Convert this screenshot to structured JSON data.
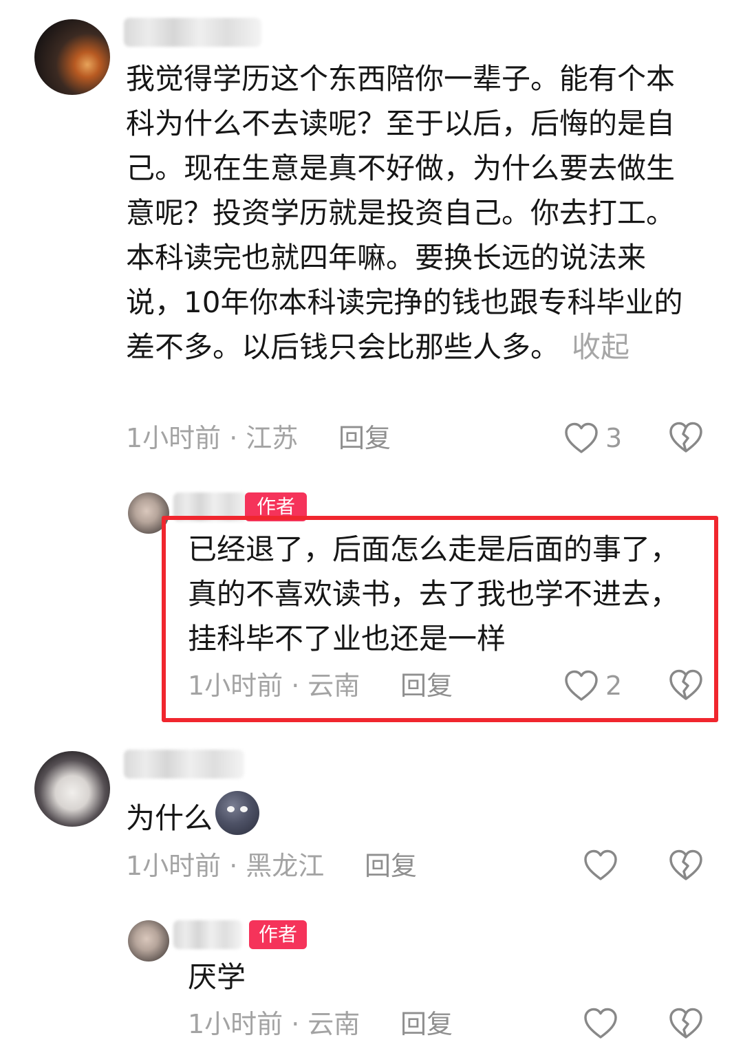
{
  "comments": [
    {
      "text": "我觉得学历这个东西陪你一辈子。能有个本科为什么不去读呢？至于以后，后悔的是自己。现在生意是真不好做，为什么要去做生意呢？投资学历就是投资自己。你去打工。本科读完也就四年嘛。要换长远的说法来说，10年你本科读完挣的钱也跟专科毕业的差不多。以后钱只会比那些人多。",
      "collapse_label": "收起",
      "time": "1小时前",
      "location": "江苏",
      "reply_label": "回复",
      "likes": "3"
    },
    {
      "badge": "作者",
      "text": "已经退了，后面怎么走是后面的事了，真的不喜欢读书，去了我也学不进去，挂科毕不了业也还是一样",
      "time": "1小时前",
      "location": "云南",
      "reply_label": "回复",
      "likes": "2"
    },
    {
      "text": "为什么",
      "emoji": "new-moon-face",
      "time": "1小时前",
      "location": "黑龙江",
      "reply_label": "回复",
      "likes": ""
    },
    {
      "badge": "作者",
      "text": "厌学",
      "time": "1小时前",
      "location": "云南",
      "reply_label": "回复",
      "likes": ""
    }
  ],
  "meta_separator": "·",
  "icons": {
    "like": "heart-outline-icon",
    "dislike": "broken-heart-icon"
  },
  "colors": {
    "highlight_border": "#f0262e",
    "author_badge": "#f5335a",
    "meta_text": "#a3a3a3"
  }
}
